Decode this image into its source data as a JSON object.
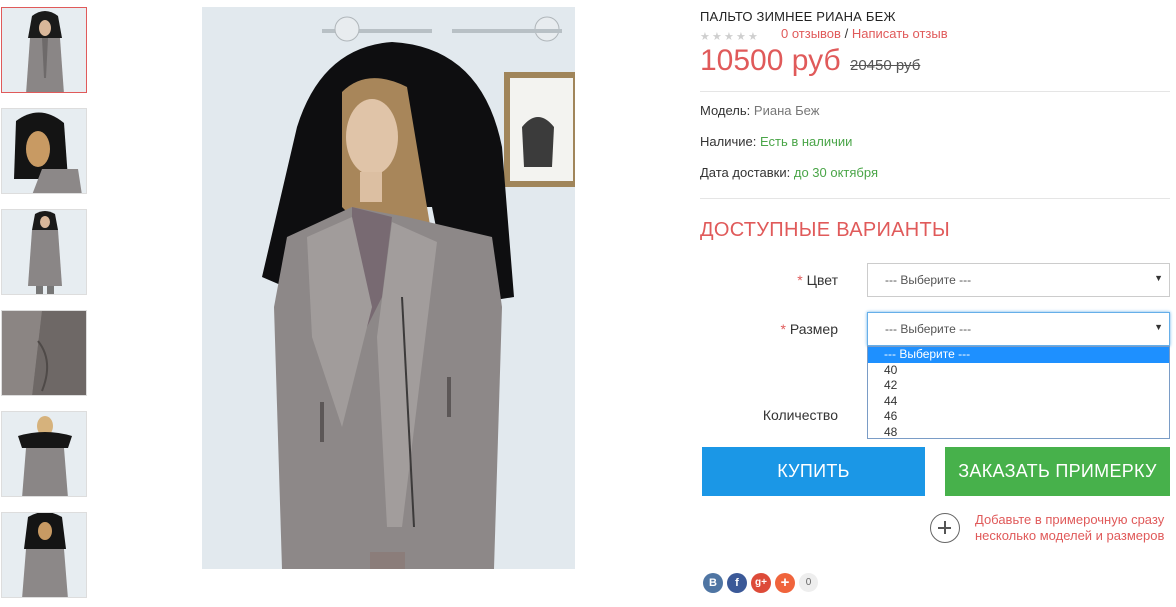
{
  "product": {
    "title": "ПАЛЬТО ЗИМНЕЕ РИАНА БЕЖ",
    "rating": 0,
    "reviews_link": "0 отзывов",
    "separator": "/",
    "write_review": "Написать отзыв",
    "price": "10500 руб",
    "old_price": "20450 руб",
    "model_label": "Модель:",
    "model_value": "Риана Беж",
    "availability_label": "Наличие:",
    "availability_value": "Есть в наличии",
    "delivery_label": "Дата доставки:",
    "delivery_value": "до 30 октября"
  },
  "options": {
    "heading": "ДОСТУПНЫЕ ВАРИАНТЫ",
    "required_mark": "*",
    "color_label": "Цвет",
    "color_value": "--- Выберите ---",
    "size_label": "Размер",
    "size_value": "--- Выберите ---",
    "size_options": [
      "--- Выберите ---",
      "40",
      "42",
      "44",
      "46",
      "48"
    ],
    "quantity_label": "Количество"
  },
  "buttons": {
    "buy": "КУПИТЬ",
    "order_fitting": "ЗАКАЗАТЬ ПРИМЕРКУ"
  },
  "hint": "Добавьте в примерочную сразу несколько моделей и размеров",
  "social": {
    "vk": "В",
    "facebook": "f",
    "google": "g+",
    "more": "+",
    "share_count": "0"
  },
  "colors": {
    "accent": "#e05a5a",
    "buy": "#1b97e6",
    "fitting": "#47b14b",
    "in_stock": "#4aa548"
  }
}
